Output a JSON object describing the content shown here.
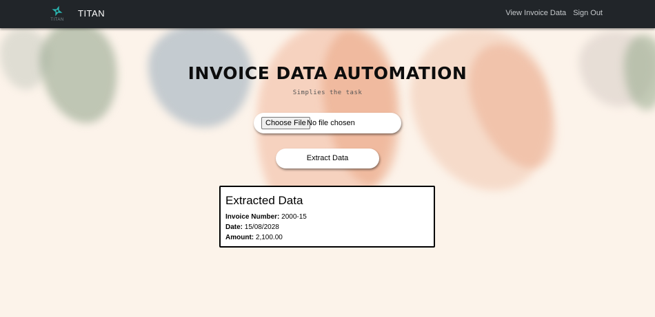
{
  "header": {
    "brand": "TITAN",
    "logo_text": "TITAN",
    "logo_icon": "titan-star-icon",
    "accent_color": "#2bb5b0",
    "nav": [
      {
        "label": "View Invoice Data"
      },
      {
        "label": "Sign Out"
      }
    ]
  },
  "hero": {
    "title": "INVOICE DATA AUTOMATION",
    "subtitle": "Simplies the task"
  },
  "upload": {
    "button_label": "Choose File",
    "status": "No file chosen"
  },
  "extract_button": "Extract Data",
  "result": {
    "title": "Extracted Data",
    "fields": [
      {
        "label": "Invoice Number:",
        "value": "2000-15"
      },
      {
        "label": "Date:",
        "value": "15/08/2028"
      },
      {
        "label": "Amount:",
        "value": "2,100.00"
      }
    ]
  }
}
